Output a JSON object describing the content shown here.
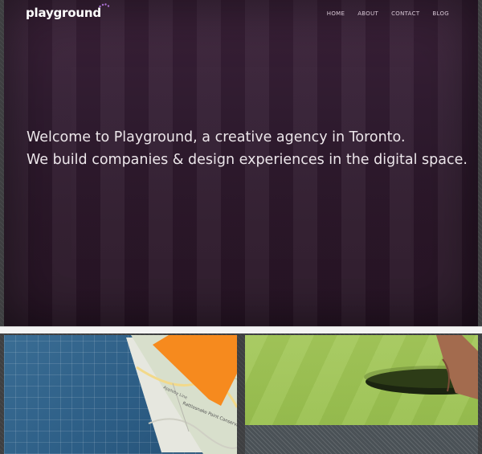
{
  "header": {
    "logo_text": "playground",
    "nav": [
      {
        "label": "HOME"
      },
      {
        "label": "ABOUT"
      },
      {
        "label": "CONTACT"
      },
      {
        "label": "BLOG"
      }
    ]
  },
  "hero": {
    "line1": "Welcome to Playground, a creative agency in Toronto.",
    "line2": "We build companies & design experiences in the digital space."
  },
  "tiles": {
    "map_labels": [
      "Rattlesnake Point Conservation Area",
      "Appleby Line"
    ]
  },
  "colors": {
    "hero_bg": "#2b1729",
    "logo_accent": "#a86fd0",
    "blueprint": "#2c5d85",
    "orange": "#f68a1e",
    "grass": "#9bc252"
  }
}
